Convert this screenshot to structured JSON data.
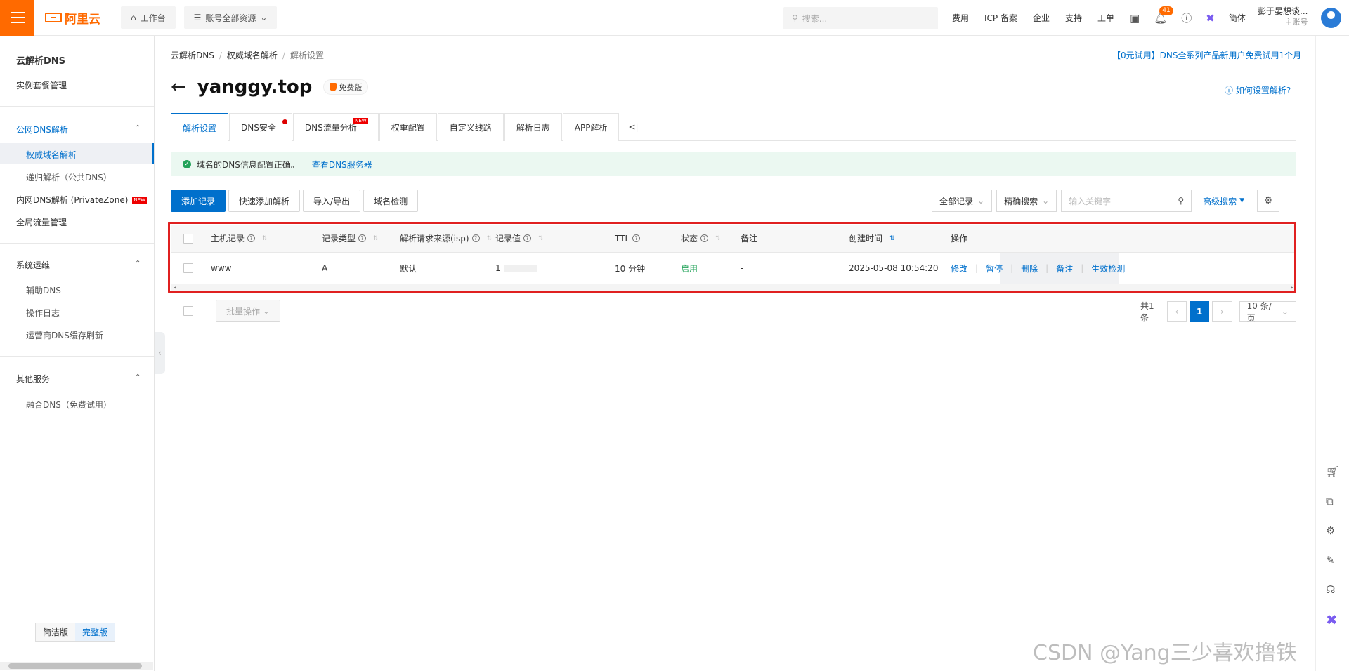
{
  "topbar": {
    "logo": "阿里云",
    "workbench": "工作台",
    "resources": "账号全部资源",
    "search_placeholder": "搜索...",
    "links": [
      "费用",
      "ICP 备案",
      "企业",
      "支持",
      "工单"
    ],
    "notification_count": "41",
    "language": "简体",
    "user_name": "彭于晏想谈...",
    "user_role": "主账号",
    "accent": "#ff6a00"
  },
  "sidebar": {
    "title": "云解析DNS",
    "instance_mgmt": "实例套餐管理",
    "group_public": "公网DNS解析",
    "authoritative": "权威域名解析",
    "recursive": "递归解析（公共DNS）",
    "private_zone": "内网DNS解析 (PrivateZone)",
    "new_tag": "NEW",
    "gtm": "全局流量管理",
    "group_ops": "系统运维",
    "aux_dns": "辅助DNS",
    "op_log": "操作日志",
    "cache_refresh": "运营商DNS缓存刷新",
    "group_other": "其他服务",
    "fusion_dns": "融合DNS（免费试用）",
    "toggle_simple": "简洁版",
    "toggle_full": "完整版"
  },
  "breadcrumb": [
    "云解析DNS",
    "权威域名解析",
    "解析设置"
  ],
  "promo": "【0元试用】DNS全系列产品新用户免费试用1个月",
  "domain": "yanggy.top",
  "edition": "免费版",
  "how_to": "如何设置解析?",
  "tabs": [
    "解析设置",
    "DNS安全",
    "DNS流量分析",
    "权重配置",
    "自定义线路",
    "解析日志",
    "APP解析"
  ],
  "tab_new": "NEW",
  "tab_more": "<|",
  "alert": {
    "text": "域名的DNS信息配置正确。",
    "link": "查看DNS服务器"
  },
  "toolbar": {
    "add": "添加记录",
    "quick_add": "快速添加解析",
    "import_export": "导入/导出",
    "check": "域名检测",
    "filter_all": "全部记录",
    "precise": "精确搜索",
    "keyword_placeholder": "输入关键字",
    "advanced": "高级搜索"
  },
  "table": {
    "headers": [
      "主机记录",
      "记录类型",
      "解析请求来源(isp)",
      "记录值",
      "TTL",
      "状态",
      "备注",
      "创建时间",
      "操作"
    ],
    "rows": [
      {
        "host": "www",
        "type": "A",
        "isp": "默认",
        "value": "1",
        "ttl": "10 分钟",
        "status": "启用",
        "remark": "-",
        "created": "2025-05-08 10:54:20",
        "ops": [
          "修改",
          "暂停",
          "删除",
          "备注",
          "生效检测"
        ]
      }
    ]
  },
  "footer": {
    "batch": "批量操作",
    "total": "共1条",
    "page": "1",
    "page_size": "10 条/页"
  },
  "watermark": "CSDN @Yang三少喜欢撸铁"
}
